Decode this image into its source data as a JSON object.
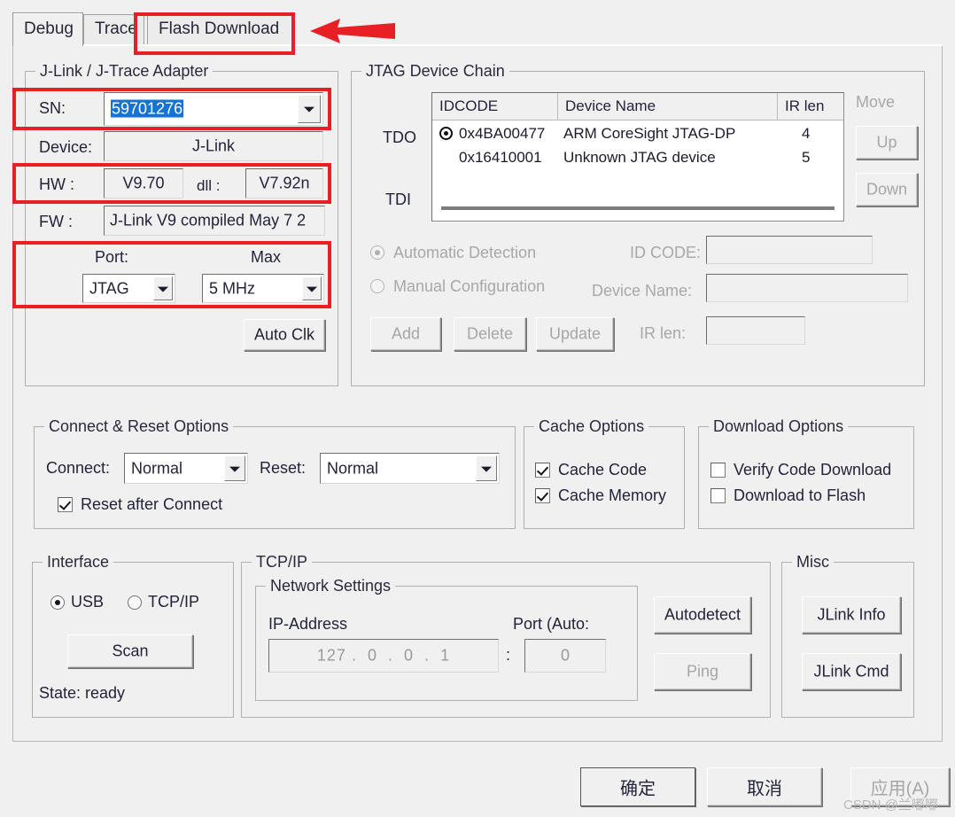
{
  "dialog": {
    "tabs": [
      {
        "label": "Debug",
        "selected": true
      },
      {
        "label": "Trace",
        "selected": false
      },
      {
        "label": "Flash Download",
        "selected": false
      }
    ]
  },
  "adapter": {
    "title": "J-Link / J-Trace Adapter",
    "sn_label": "SN:",
    "sn_value": "59701276",
    "device_label": "Device:",
    "device_value": "J-Link",
    "hw_label": "HW :",
    "hw_value": "V9.70",
    "dll_label": "dll :",
    "dll_value": "V7.92n",
    "fw_label": "FW :",
    "fw_value": "J-Link V9 compiled May  7 2",
    "port_label": "Port:",
    "port_value": "JTAG",
    "max_label": "Max",
    "max_value": "5 MHz",
    "auto_clk_label": "Auto Clk"
  },
  "jtag_chain": {
    "title": "JTAG Device Chain",
    "tdo_label": "TDO",
    "tdi_label": "TDI",
    "columns": [
      "IDCODE",
      "Device Name",
      "IR len"
    ],
    "rows": [
      {
        "idcode": "0x4BA00477",
        "device_name": "ARM CoreSight JTAG-DP",
        "ir_len": "4",
        "selected": true
      },
      {
        "idcode": "0x16410001",
        "device_name": "Unknown JTAG device",
        "ir_len": "5",
        "selected": false
      }
    ],
    "move_label": "Move",
    "up_label": "Up",
    "down_label": "Down",
    "automatic_detection_label": "Automatic Detection",
    "manual_configuration_label": "Manual Configuration",
    "id_code_label": "ID CODE:",
    "id_code_value": "",
    "device_name_label": "Device Name:",
    "device_name_value": "",
    "ir_len_label": "IR len:",
    "ir_len_value": "",
    "add_label": "Add",
    "delete_label": "Delete",
    "update_label": "Update"
  },
  "connect_reset": {
    "title": "Connect & Reset Options",
    "connect_label": "Connect:",
    "connect_value": "Normal",
    "reset_label": "Reset:",
    "reset_value": "Normal",
    "reset_after_connect_label": "Reset after Connect"
  },
  "cache": {
    "title": "Cache Options",
    "cache_code_label": "Cache Code",
    "cache_memory_label": "Cache Memory"
  },
  "download": {
    "title": "Download Options",
    "verify_label": "Verify Code Download",
    "flash_label": "Download to Flash"
  },
  "interface": {
    "title": "Interface",
    "usb_label": "USB",
    "tcpip_label": "TCP/IP",
    "scan_label": "Scan",
    "state_label": "State: ready"
  },
  "tcpip": {
    "title": "TCP/IP",
    "network_settings_title": "Network Settings",
    "ip_label": "IP-Address",
    "ip_octets": [
      "127",
      "0",
      "0",
      "1"
    ],
    "ip_sep": ".",
    "port_label": "Port (Auto:",
    "port_colon": ":",
    "port_value": "0",
    "autodetect_label": "Autodetect",
    "ping_label": "Ping"
  },
  "misc": {
    "title": "Misc",
    "jlink_info_label": "JLink Info",
    "jlink_cmd_label": "JLink Cmd"
  },
  "footer": {
    "ok_label": "确定",
    "cancel_label": "取消",
    "apply_label": "应用(A)",
    "watermark": "CSDN @兰嘟嘟"
  },
  "colors": {
    "annotation_red": "#e81f25",
    "selection_blue": "#1673d6",
    "dialog_bg": "#f0f0f0"
  }
}
